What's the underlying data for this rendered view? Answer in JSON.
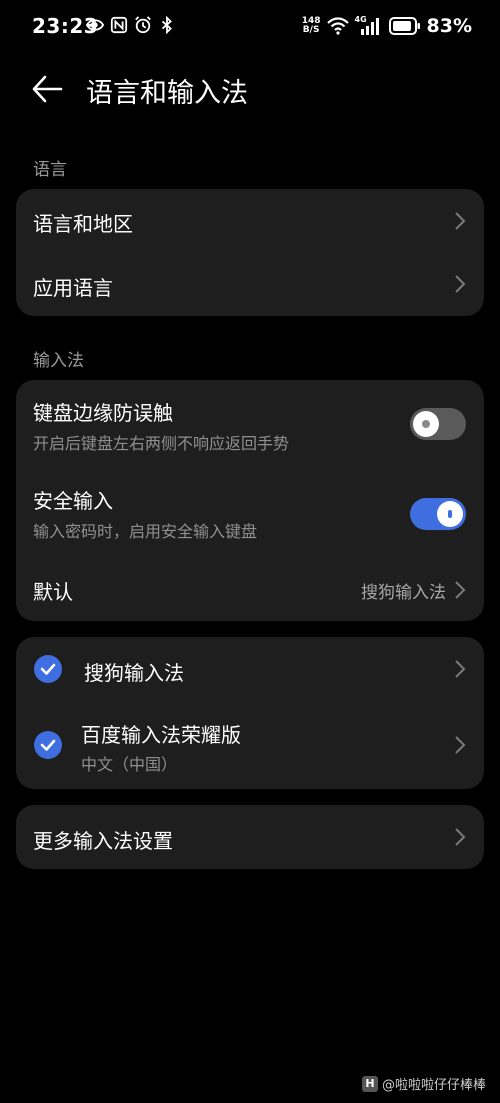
{
  "status": {
    "time": "23:23",
    "net_speed_top": "148",
    "net_speed_bottom": "B/S",
    "network": "4G",
    "battery": "83%"
  },
  "header": {
    "title": "语言和输入法"
  },
  "language_section": {
    "label": "语言",
    "items": [
      {
        "title": "语言和地区"
      },
      {
        "title": "应用语言"
      }
    ]
  },
  "input_section": {
    "label": "输入法",
    "edge_protection": {
      "title": "键盘边缘防误触",
      "subtitle": "开启后键盘左右两侧不响应返回手势",
      "enabled": false
    },
    "secure_input": {
      "title": "安全输入",
      "subtitle": "输入密码时，启用安全输入键盘",
      "enabled": true
    },
    "default": {
      "title": "默认",
      "value": "搜狗输入法"
    }
  },
  "keyboards": [
    {
      "name": "搜狗输入法",
      "checked": true
    },
    {
      "name": "百度输入法荣耀版",
      "subtitle": "中文（中国）",
      "checked": true
    }
  ],
  "more": {
    "title": "更多输入法设置"
  },
  "watermark": {
    "logo": "H",
    "text": "@啦啦啦仔仔棒棒"
  },
  "colors": {
    "accent": "#3f6ee0",
    "card": "#1e1e1e",
    "background": "#000000"
  }
}
